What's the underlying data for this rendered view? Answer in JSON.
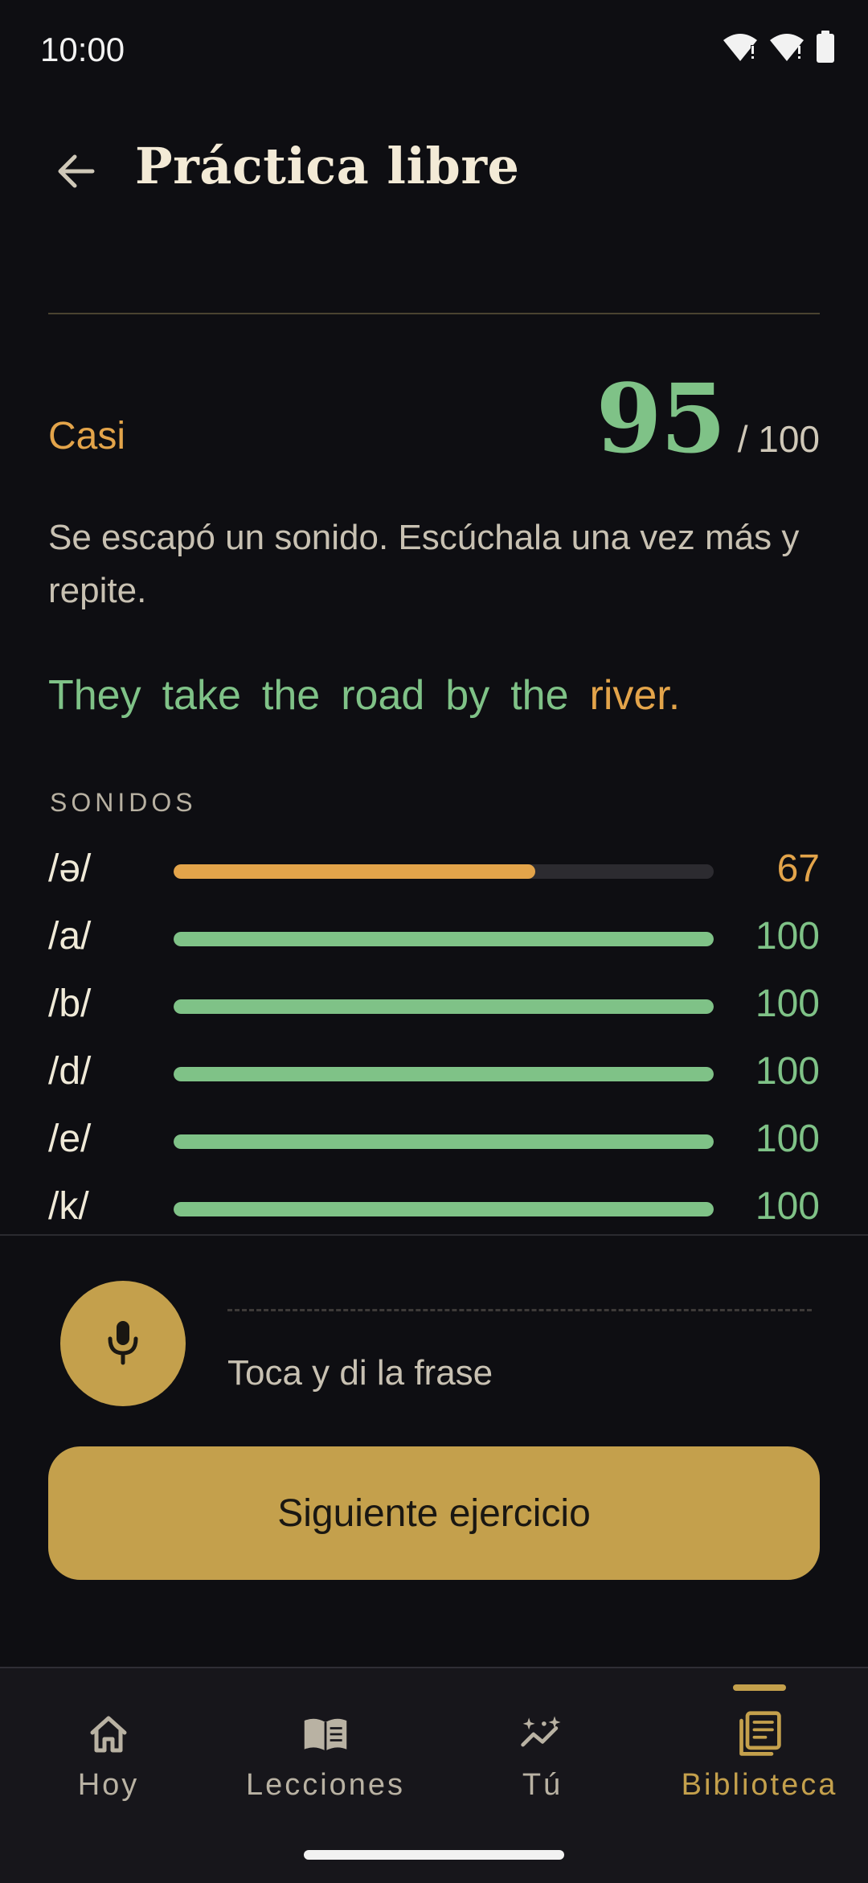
{
  "status_bar": {
    "time": "10:00"
  },
  "header": {
    "title": "Práctica libre",
    "back_icon": "arrow-left-icon"
  },
  "result": {
    "grade": "Casi",
    "score": "95",
    "score_max": "/ 100",
    "feedback": "Se escapó un sonido. Escúchala una vez más y repite."
  },
  "phrase": {
    "words": [
      {
        "text": "They",
        "status": "good"
      },
      {
        "text": "take",
        "status": "good"
      },
      {
        "text": "the",
        "status": "good"
      },
      {
        "text": "road",
        "status": "good"
      },
      {
        "text": "by",
        "status": "good"
      },
      {
        "text": "the",
        "status": "good"
      },
      {
        "text": "river.",
        "status": "warn"
      }
    ]
  },
  "sounds": {
    "label": "SONIDOS",
    "items": [
      {
        "phoneme": "/ə/",
        "score": 67
      },
      {
        "phoneme": "/a/",
        "score": 100
      },
      {
        "phoneme": "/b/",
        "score": 100
      },
      {
        "phoneme": "/d/",
        "score": 100
      },
      {
        "phoneme": "/e/",
        "score": 100
      },
      {
        "phoneme": "/k/",
        "score": 100
      }
    ]
  },
  "recorder": {
    "icon": "microphone-icon",
    "hint": "Toca y di la frase"
  },
  "actions": {
    "next_label": "Siguiente ejercicio"
  },
  "nav": {
    "items": [
      {
        "label": "Hoy",
        "icon": "home-icon",
        "active": false
      },
      {
        "label": "Lecciones",
        "icon": "book-icon",
        "active": false
      },
      {
        "label": "Tú",
        "icon": "progress-sparkle-icon",
        "active": false
      },
      {
        "label": "Biblioteca",
        "icon": "library-icon",
        "active": true
      }
    ]
  },
  "colors": {
    "background": "#0e0e12",
    "accent": "#c4a04c",
    "good": "#7fc287",
    "warn": "#e3a44a",
    "track": "#2c2b30"
  }
}
